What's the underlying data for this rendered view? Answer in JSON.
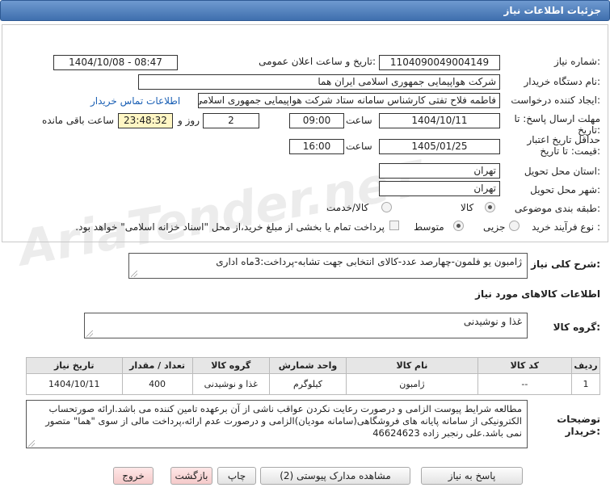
{
  "header": {
    "title": "جزئیات اطلاعات نیاز"
  },
  "fields": {
    "need_number_label": "شماره نیاز:",
    "need_number": "1104090049004149",
    "announce_label": "تاریخ و ساعت اعلان عمومی:",
    "announce_value": "1404/10/08 - 08:47",
    "buyer_label": "نام دستگاه خریدار:",
    "buyer_value": "شرکت هواپیمایی جمهوری اسلامی ایران هما",
    "creator_label": "ایجاد کننده درخواست:",
    "creator_value": "فاطمه فلاح تفتی کارشناس سامانه ستاد شرکت هواپیمایی جمهوری اسلامی ا",
    "contact_link": "اطلاعات تماس خریدار",
    "reply_deadline_label": "مهلت ارسال پاسخ: تا تاریخ:",
    "reply_date": "1404/10/11",
    "time_label": "ساعت",
    "reply_time": "09:00",
    "days_value": "2",
    "days_and_label": "روز و",
    "remaining_time": "23:48:32",
    "remaining_label": "ساعت باقی مانده",
    "validity_label": "حداقل تاریخ اعتبار قیمت: تا تاریخ:",
    "validity_date": "1405/01/25",
    "validity_time": "16:00",
    "province_label": "استان محل تحویل:",
    "province_value": "تهران",
    "city_label": "شهر محل تحویل:",
    "city_value": "تهران",
    "category_label": "طبقه بندی موضوعی:",
    "category_goods": "کالا",
    "category_service": "کالا/خدمت",
    "process_label": "نوع فرآیند خرید :",
    "process_partial": "جزیی",
    "process_medium": "متوسط",
    "payment_note": "پرداخت تمام یا بخشی از مبلغ خرید،از محل \"اسناد خزانه اسلامی\" خواهد بود."
  },
  "general_desc": {
    "label": "شرح کلی نیاز:",
    "value": "ژامبون یو فلمون-چهارصد عدد-کالای انتخابی جهت تشابه-پرداخت:3ماه اداری"
  },
  "goods_section_title": "اطلاعات کالاهای مورد نیاز",
  "goods_group": {
    "label": "گروه کالا:",
    "value": "غذا و نوشیدنی"
  },
  "table": {
    "headers": [
      "ردیف",
      "کد کالا",
      "نام کالا",
      "واحد شمارش",
      "گروه کالا",
      "تعداد / مقدار",
      "تاریخ نیاز"
    ],
    "rows": [
      [
        "1",
        "--",
        "ژامبون",
        "کیلوگرم",
        "غذا و نوشیدنی",
        "400",
        "1404/10/11"
      ]
    ]
  },
  "buyer_notes": {
    "label": "توضیحات خریدار:",
    "value": "مطالعه شرایط پیوست الزامی و درصورت رعایت نکردن عواقب ناشی از آن برعهده تامین کننده می باشد.ارائه صورتحساب الکترونیکی از سامانه پایانه های فروشگاهی(سامانه مودیان)الزامی و درصورت عدم ارائه،پرداخت مالی از سوی \"هما\" متصور نمی باشد.علی رنجبر زاده 46624623"
  },
  "buttons": {
    "reply": "پاسخ به نیاز",
    "docs": "مشاهده مدارک پیوستی (2)",
    "print": "چاپ",
    "back": "بازگشت",
    "exit": "خروج"
  },
  "watermark": {
    "text": "AriaTender.neT"
  }
}
